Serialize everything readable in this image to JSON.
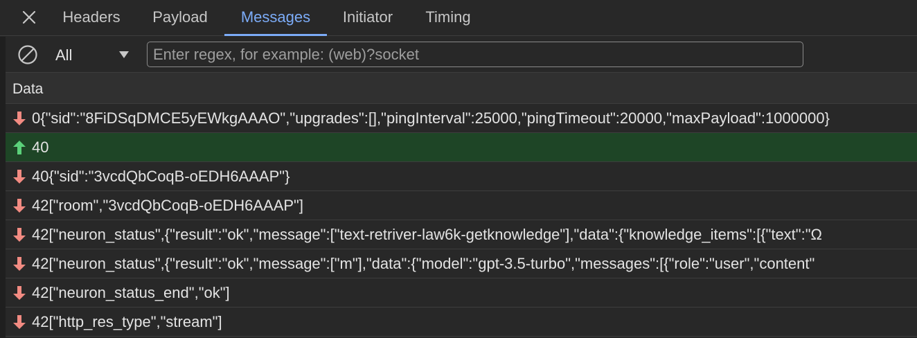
{
  "panel": {
    "tabs": [
      {
        "label": "Headers",
        "active": false
      },
      {
        "label": "Payload",
        "active": false
      },
      {
        "label": "Messages",
        "active": true
      },
      {
        "label": "Initiator",
        "active": false
      },
      {
        "label": "Timing",
        "active": false
      }
    ]
  },
  "toolbar": {
    "type_filter": "All",
    "filter_placeholder": "Enter regex, for example: (web)?socket",
    "filter_value": ""
  },
  "table": {
    "column_header": "Data",
    "rows": [
      {
        "direction": "received",
        "text": "0{\"sid\":\"8FiDSqDMCE5yEWkgAAAO\",\"upgrades\":[],\"pingInterval\":25000,\"pingTimeout\":20000,\"maxPayload\":1000000}"
      },
      {
        "direction": "sent",
        "text": "40"
      },
      {
        "direction": "received",
        "text": "40{\"sid\":\"3vcdQbCoqB-oEDH6AAAP\"}"
      },
      {
        "direction": "received",
        "text": "42[\"room\",\"3vcdQbCoqB-oEDH6AAAP\"]"
      },
      {
        "direction": "received",
        "text": "42[\"neuron_status\",{\"result\":\"ok\",\"message\":[\"text-retriver-law6k-getknowledge\"],\"data\":{\"knowledge_items\":[{\"text\":\"Ω"
      },
      {
        "direction": "received",
        "text": "42[\"neuron_status\",{\"result\":\"ok\",\"message\":[\"m\"],\"data\":{\"model\":\"gpt-3.5-turbo\",\"messages\":[{\"role\":\"user\",\"content\""
      },
      {
        "direction": "received",
        "text": "42[\"neuron_status_end\",\"ok\"]"
      },
      {
        "direction": "received",
        "text": "42[\"http_res_type\",\"stream\"]"
      }
    ]
  },
  "colors": {
    "received_arrow": "#f28b82",
    "sent_arrow": "#5bd17a",
    "sent_row_bg": "#1e4526",
    "active_tab": "#7cacf8"
  },
  "icons": {
    "close": "close-icon",
    "clear": "clear-icon",
    "dropdown": "chevron-down-icon",
    "received": "arrow-down-icon",
    "sent": "arrow-up-icon"
  }
}
